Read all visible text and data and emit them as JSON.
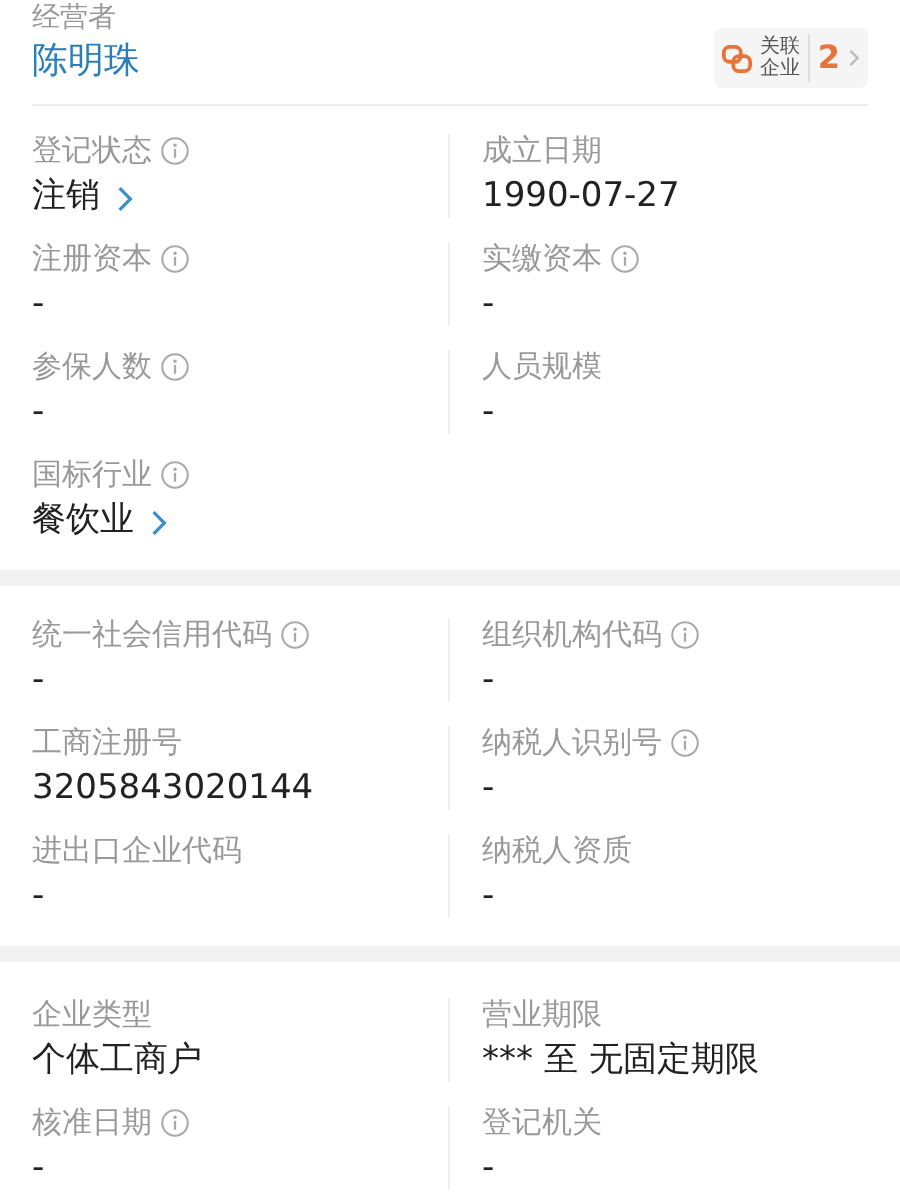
{
  "operator": {
    "label": "经营者",
    "name": "陈明珠",
    "related": {
      "label_top": "关联",
      "label_bottom": "企业",
      "count": "2"
    }
  },
  "sections": [
    {
      "rows": [
        [
          {
            "label": "登记状态",
            "info": true,
            "value": "注销",
            "link": true
          },
          {
            "label": "成立日期",
            "info": false,
            "value": "1990-07-27",
            "link": false
          }
        ],
        [
          {
            "label": "注册资本",
            "info": true,
            "value": "-",
            "link": false
          },
          {
            "label": "实缴资本",
            "info": true,
            "value": "-",
            "link": false
          }
        ],
        [
          {
            "label": "参保人数",
            "info": true,
            "value": "-",
            "link": false
          },
          {
            "label": "人员规模",
            "info": false,
            "value": "-",
            "link": false
          }
        ],
        [
          {
            "label": "国标行业",
            "info": true,
            "value": "餐饮业",
            "link": true
          }
        ]
      ]
    },
    {
      "rows": [
        [
          {
            "label": "统一社会信用代码",
            "info": true,
            "value": "-",
            "link": false
          },
          {
            "label": "组织机构代码",
            "info": true,
            "value": "-",
            "link": false
          }
        ],
        [
          {
            "label": "工商注册号",
            "info": false,
            "value": "3205843020144",
            "link": false
          },
          {
            "label": "纳税人识别号",
            "info": true,
            "value": "-",
            "link": false
          }
        ],
        [
          {
            "label": "进出口企业代码",
            "info": false,
            "value": "-",
            "link": false
          },
          {
            "label": "纳税人资质",
            "info": false,
            "value": "-",
            "link": false
          }
        ]
      ]
    },
    {
      "rows": [
        [
          {
            "label": "企业类型",
            "info": false,
            "value": "个体工商户",
            "link": false
          },
          {
            "label": "营业期限",
            "info": false,
            "value": "*** 至 无固定期限",
            "link": false
          }
        ],
        [
          {
            "label": "核准日期",
            "info": true,
            "value": "-",
            "link": false
          },
          {
            "label": "登记机关",
            "info": false,
            "value": "-",
            "link": false
          }
        ]
      ]
    }
  ]
}
